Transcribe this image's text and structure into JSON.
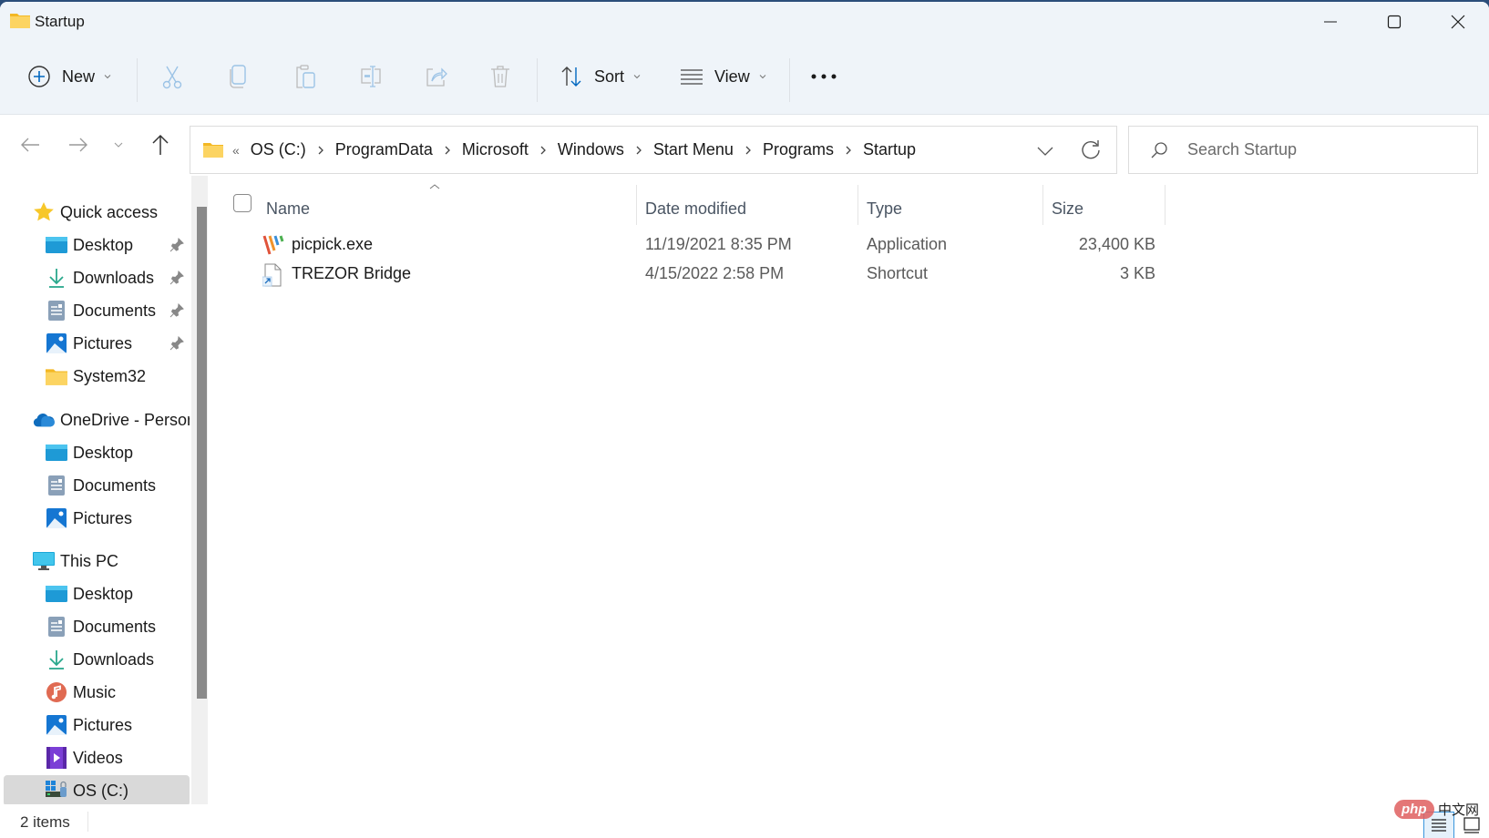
{
  "window": {
    "title": "Startup",
    "controls": {
      "minimize": "Minimize",
      "maximize": "Maximize",
      "close": "Close"
    }
  },
  "toolbar": {
    "new_label": "New",
    "sort_label": "Sort",
    "view_label": "View",
    "icons": [
      "add-circle-icon",
      "cut-icon",
      "copy-icon",
      "paste-icon",
      "rename-icon",
      "share-icon",
      "delete-icon",
      "sort-icon",
      "view-list-icon",
      "more-icon"
    ]
  },
  "navigation": {
    "address": {
      "overflow": "«",
      "crumbs": [
        "OS (C:)",
        "ProgramData",
        "Microsoft",
        "Windows",
        "Start Menu",
        "Programs",
        "Startup"
      ]
    },
    "search": {
      "placeholder": "Search Startup",
      "value": ""
    }
  },
  "sidebar": {
    "quick_access": {
      "label": "Quick access",
      "items": [
        {
          "label": "Desktop",
          "icon": "desktop-icon",
          "pinned": true
        },
        {
          "label": "Downloads",
          "icon": "download-icon",
          "pinned": true
        },
        {
          "label": "Documents",
          "icon": "documents-icon",
          "pinned": true
        },
        {
          "label": "Pictures",
          "icon": "pictures-icon",
          "pinned": true
        },
        {
          "label": "System32",
          "icon": "folder-icon",
          "pinned": false
        }
      ]
    },
    "onedrive": {
      "label": "OneDrive - Personal",
      "items": [
        {
          "label": "Desktop",
          "icon": "desktop-icon"
        },
        {
          "label": "Documents",
          "icon": "documents-icon"
        },
        {
          "label": "Pictures",
          "icon": "pictures-icon"
        }
      ]
    },
    "this_pc": {
      "label": "This PC",
      "items": [
        {
          "label": "Desktop",
          "icon": "desktop-icon"
        },
        {
          "label": "Documents",
          "icon": "documents-icon"
        },
        {
          "label": "Downloads",
          "icon": "download-icon"
        },
        {
          "label": "Music",
          "icon": "music-icon"
        },
        {
          "label": "Pictures",
          "icon": "pictures-icon"
        },
        {
          "label": "Videos",
          "icon": "videos-icon"
        },
        {
          "label": "OS (C:)",
          "icon": "drive-icon",
          "selected": true
        }
      ]
    }
  },
  "file_list": {
    "columns": [
      "Name",
      "Date modified",
      "Type",
      "Size"
    ],
    "sort_column": "Name",
    "sort_direction": "ascending",
    "rows": [
      {
        "name": "picpick.exe",
        "date_modified": "11/19/2021 8:35 PM",
        "type": "Application",
        "size": "23,400 KB",
        "icon": "picpick-app-icon"
      },
      {
        "name": "TREZOR Bridge",
        "date_modified": "4/15/2022 2:58 PM",
        "type": "Shortcut",
        "size": "3 KB",
        "icon": "shortcut-icon"
      }
    ]
  },
  "status": {
    "item_count": "2 items",
    "view_modes": [
      "details",
      "large-icons"
    ],
    "active_view": "details"
  },
  "watermark": {
    "brand": "php",
    "text": "中文网"
  },
  "colors": {
    "accent": "#0067c0",
    "toolbar_bg": "#eff4f9",
    "selected_bg": "#d9d9d9",
    "folder_yellow": "#f8c948"
  }
}
